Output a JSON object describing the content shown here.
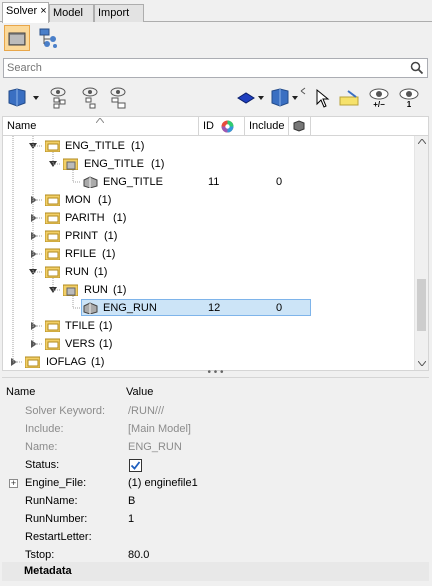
{
  "tabs": [
    {
      "label": "Solver",
      "close": "×"
    },
    {
      "label": "Model"
    },
    {
      "label": "Import"
    }
  ],
  "search": {
    "placeholder": "Search"
  },
  "tree": {
    "columns": {
      "name": "Name",
      "id": "ID",
      "include": "Include"
    },
    "rows": [
      {
        "label": "ENG_TITLE",
        "count": "(1)",
        "id": "",
        "include": ""
      },
      {
        "label": "ENG_TITLE",
        "count": "(1)",
        "id": "",
        "include": ""
      },
      {
        "label": "ENG_TITLE",
        "count": "",
        "id": "11",
        "include": "0"
      },
      {
        "label": "MON",
        "count": "(1)",
        "id": "",
        "include": ""
      },
      {
        "label": "PARITH",
        "count": "(1)",
        "id": "",
        "include": ""
      },
      {
        "label": "PRINT",
        "count": "(1)",
        "id": "",
        "include": ""
      },
      {
        "label": "RFILE",
        "count": "(1)",
        "id": "",
        "include": ""
      },
      {
        "label": "RUN",
        "count": "(1)",
        "id": "",
        "include": ""
      },
      {
        "label": "RUN",
        "count": "(1)",
        "id": "",
        "include": ""
      },
      {
        "label": "ENG_RUN",
        "count": "",
        "id": "12",
        "include": "0"
      },
      {
        "label": "TFILE",
        "count": "(1)",
        "id": "",
        "include": ""
      },
      {
        "label": "VERS",
        "count": "(1)",
        "id": "",
        "include": ""
      },
      {
        "label": "IOFLAG",
        "count": "(1)",
        "id": "",
        "include": ""
      }
    ]
  },
  "splitter": {
    "grip": "• • •"
  },
  "props": {
    "headers": {
      "name": "Name",
      "value": "Value"
    },
    "rows": [
      {
        "key": "Solver Keyword:",
        "value": "/RUN///"
      },
      {
        "key": "Include:",
        "value": "[Main Model]"
      },
      {
        "key": "Name:",
        "value": "ENG_RUN"
      },
      {
        "key": "Status:",
        "value": ""
      },
      {
        "key": "Engine_File:",
        "value": "(1) enginefile1",
        "expand": "+"
      },
      {
        "key": "RunName:",
        "value": "B"
      },
      {
        "key": "RunNumber:",
        "value": "1"
      },
      {
        "key": "RestartLetter:",
        "value": ""
      },
      {
        "key": "Tstop:",
        "value": "80.0"
      }
    ],
    "section": "Metadata",
    "status_checked": true
  },
  "toolbar2": {
    "vis_plusminus": "+/−",
    "vis_one": "1"
  }
}
